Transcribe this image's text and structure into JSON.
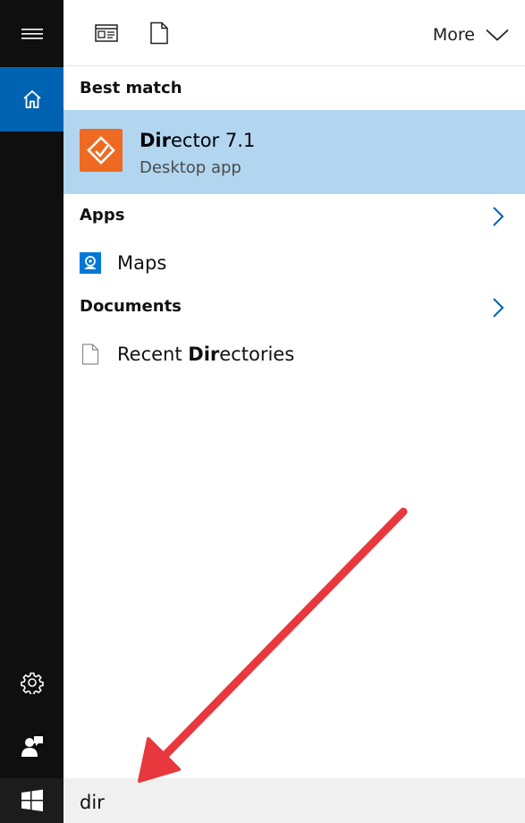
{
  "rail": {
    "items": [
      {
        "name": "menu",
        "icon": "hamburger-icon"
      },
      {
        "name": "home",
        "icon": "home-icon",
        "active": true
      },
      {
        "name": "settings",
        "icon": "gear-icon"
      },
      {
        "name": "feedback",
        "icon": "feedback-icon"
      },
      {
        "name": "start",
        "icon": "windows-logo-icon"
      }
    ],
    "active_color": "#0063b1",
    "background": "#0f0f0f"
  },
  "topbar": {
    "filters": [
      {
        "icon": "apps-filter-icon"
      },
      {
        "icon": "documents-filter-icon"
      }
    ],
    "more_label": "More",
    "more_icon": "chevron-down-icon"
  },
  "results": {
    "best_match": {
      "title": "Best match",
      "item": {
        "name_match": "Dir",
        "name_rest": "ector 7.1",
        "subtitle": "Desktop app",
        "icon": "director-app-icon",
        "icon_color": "#ee6a22",
        "highlight_color": "#b2d6f0"
      }
    },
    "apps": {
      "title": "Apps",
      "items": [
        {
          "label": "Maps",
          "icon": "maps-app-icon"
        }
      ]
    },
    "documents": {
      "title": "Documents",
      "items": [
        {
          "label_pre": "Recent ",
          "label_match": "Dir",
          "label_post": "ectories",
          "icon": "document-icon"
        }
      ]
    }
  },
  "search": {
    "value": "dir"
  },
  "annotation": {
    "arrow_color": "#e8383d",
    "icon": "red-arrow"
  }
}
